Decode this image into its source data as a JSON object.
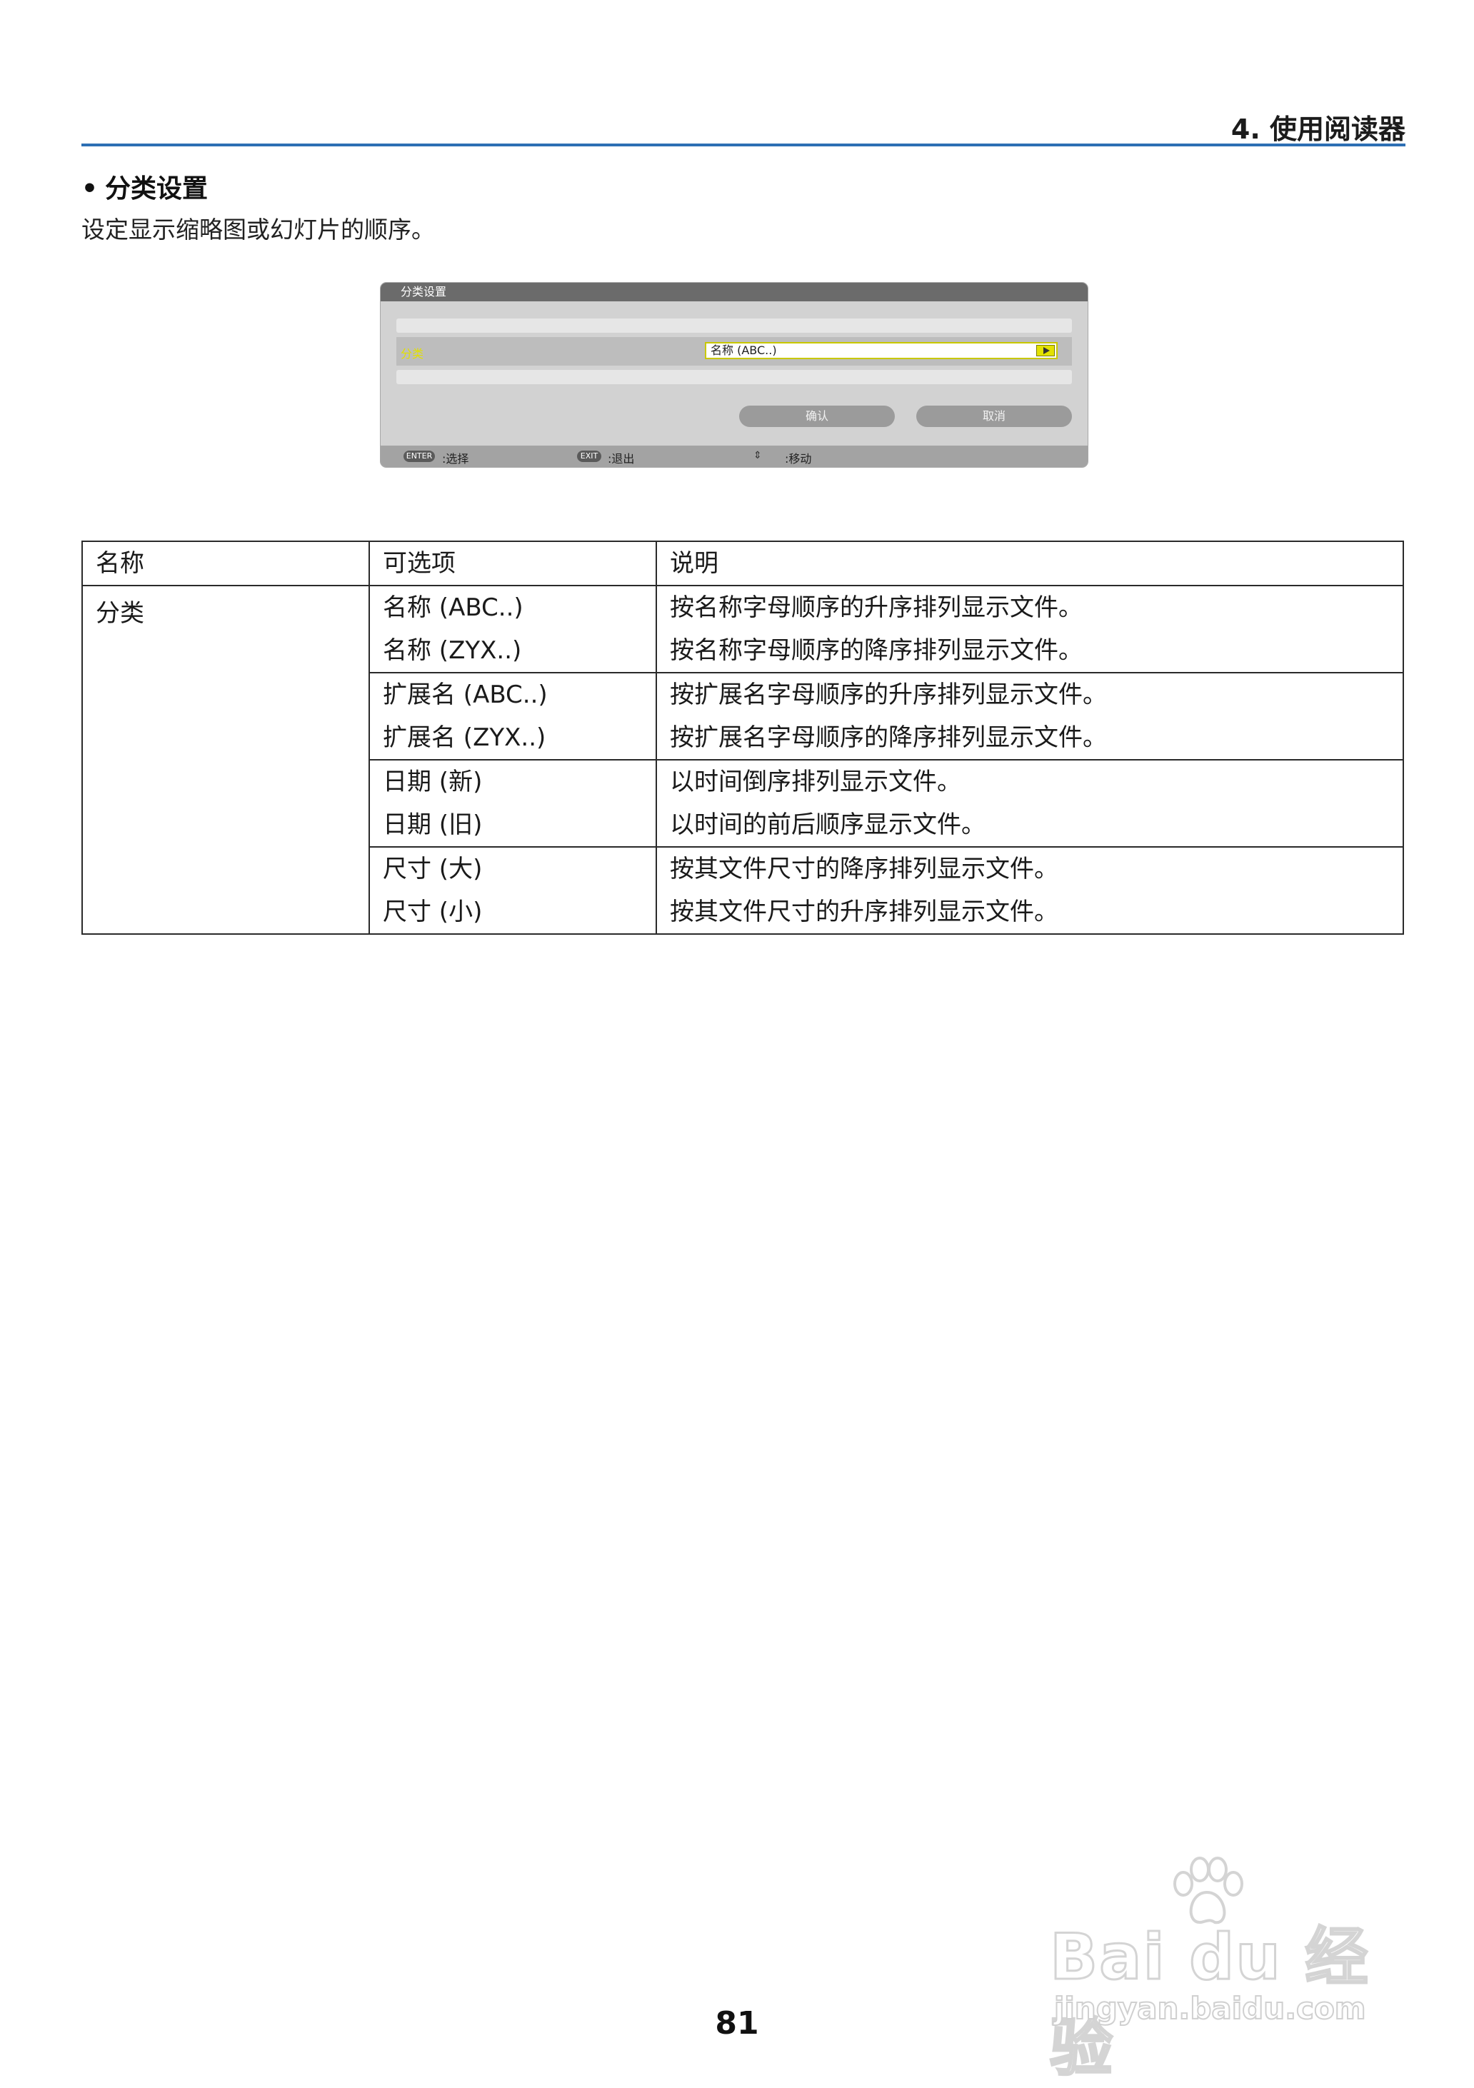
{
  "header": {
    "chapter": "4. 使用阅读器"
  },
  "section": {
    "bullet": "•",
    "title": "分类设置",
    "intro": "设定显示缩略图或幻灯片的顺序。"
  },
  "osd": {
    "title": "分类设置",
    "row_label": "分类",
    "select_value": "名称 (ABC..)",
    "ok_label": "确认",
    "cancel_label": "取消",
    "footer": {
      "enter_key": "ENTER",
      "enter_text": ":选择",
      "exit_key": "EXIT",
      "exit_text": ":退出",
      "move_text": ":移动"
    }
  },
  "table": {
    "headers": [
      "名称",
      "可选项",
      "说明"
    ],
    "name": "分类",
    "groups": [
      {
        "options": [
          "名称 (ABC..)",
          "名称 (ZYX..)"
        ],
        "descriptions": [
          "按名称字母顺序的升序排列显示文件。",
          "按名称字母顺序的降序排列显示文件。"
        ]
      },
      {
        "options": [
          "扩展名 (ABC..)",
          "扩展名 (ZYX..)"
        ],
        "descriptions": [
          "按扩展名字母顺序的升序排列显示文件。",
          "按扩展名字母顺序的降序排列显示文件。"
        ]
      },
      {
        "options": [
          "日期 (新)",
          "日期 (旧)"
        ],
        "descriptions": [
          "以时间倒序排列显示文件。",
          "以时间的前后顺序显示文件。"
        ]
      },
      {
        "options": [
          "尺寸 (大)",
          "尺寸 (小)"
        ],
        "descriptions": [
          "按其文件尺寸的降序排列显示文件。",
          "按其文件尺寸的升序排列显示文件。"
        ]
      }
    ]
  },
  "page_number": "81",
  "watermark": {
    "logo": "Bai du 经验",
    "url": "jingyan.baidu.com"
  },
  "colors": {
    "rule": "#2d6fb4",
    "osd_highlight": "#e2e000"
  }
}
